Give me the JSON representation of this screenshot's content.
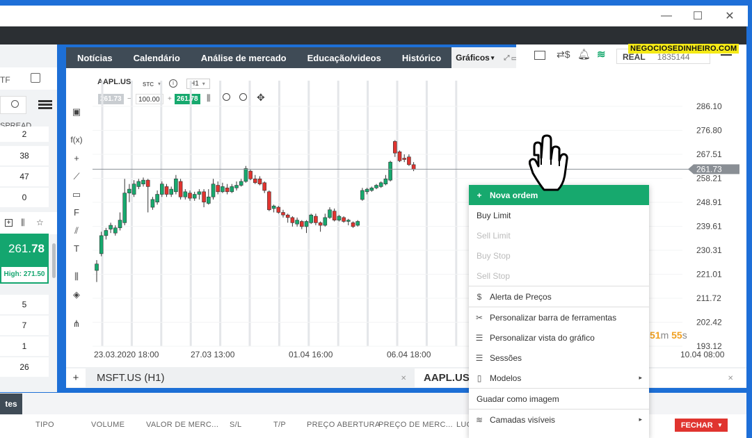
{
  "window": {
    "minimize": "—",
    "maximize": "☐",
    "close": "✕"
  },
  "nav": {
    "items": [
      "Notícias",
      "Calendário",
      "Análise de mercado",
      "Educação/videos",
      "Histórico"
    ],
    "active": "Gráficos",
    "active_arrow": "▾",
    "tab_icons": "⤢▭✕"
  },
  "badge": "NEGOCIOSEDINHEIRO.COM",
  "account": {
    "mode": "REAL",
    "number": "1835144"
  },
  "left_panel": {
    "col_label": "TF",
    "spread_label": "SPREAD",
    "rows_top": [
      "2",
      "38",
      "47",
      "0"
    ],
    "price": "261.",
    "price_bold": "78",
    "high": "High: 271.50",
    "rows_bottom": [
      "5",
      "7",
      "1",
      "26"
    ]
  },
  "chart": {
    "symbol": "AAPL.US",
    "symbol_type": "STC",
    "timeframe": "H1",
    "bid": "261.73",
    "qty": "100.00",
    "ask": "261.78",
    "qty_minus": "−",
    "qty_plus": "+",
    "last_price_label": "261.73",
    "countdown_minutes": "51",
    "countdown_m_unit": "m",
    "countdown_seconds": "55",
    "countdown_s_unit": "s"
  },
  "chart_data": {
    "type": "candlestick",
    "y_ticks": [
      "286.10",
      "276.80",
      "267.51",
      "258.21",
      "248.91",
      "239.61",
      "230.31",
      "221.01",
      "211.72",
      "202.42",
      "193.12"
    ],
    "x_ticks": [
      "23.03.2020 18:00",
      "27.03 13:00",
      "01.04 16:00",
      "06.04 18:00",
      "10.04 08:00"
    ],
    "ylim": [
      193.12,
      286.1
    ],
    "current_price": 261.73,
    "candles": [
      [
        222.5,
        225.0,
        218.0,
        226.5
      ],
      [
        229.0,
        236.0,
        228.0,
        237.5
      ],
      [
        236.0,
        238.0,
        234.5,
        239.0
      ],
      [
        238.5,
        240.0,
        237.0,
        241.0
      ],
      [
        237.0,
        239.0,
        236.0,
        240.0
      ],
      [
        239.0,
        242.0,
        238.0,
        245.0
      ],
      [
        241.0,
        252.5,
        240.0,
        258.0
      ],
      [
        252.5,
        254.0,
        249.0,
        256.0
      ],
      [
        252.0,
        256.0,
        251.0,
        257.5
      ],
      [
        255.0,
        257.0,
        254.0,
        258.0
      ],
      [
        256.0,
        257.5,
        255.0,
        258.5
      ],
      [
        257.5,
        255.0,
        245.0,
        258.0
      ],
      [
        247.0,
        250.0,
        246.0,
        251.0
      ],
      [
        249.0,
        252.0,
        248.0,
        253.5
      ],
      [
        252.0,
        256.0,
        251.0,
        257.0
      ],
      [
        255.0,
        252.0,
        251.0,
        256.0
      ],
      [
        252.0,
        254.0,
        251.0,
        255.0
      ],
      [
        253.0,
        258.0,
        252.0,
        259.5
      ],
      [
        257.0,
        251.0,
        250.0,
        258.0
      ],
      [
        251.0,
        253.0,
        250.0,
        254.0
      ],
      [
        252.5,
        250.5,
        249.5,
        253.5
      ],
      [
        250.5,
        252.0,
        249.5,
        253.0
      ],
      [
        252.0,
        253.0,
        250.0,
        254.0
      ],
      [
        253.0,
        249.0,
        247.0,
        254.0
      ],
      [
        248.5,
        251.0,
        248.0,
        254.0
      ],
      [
        251.0,
        256.0,
        250.0,
        258.0
      ],
      [
        255.5,
        253.0,
        252.0,
        257.0
      ],
      [
        253.0,
        255.0,
        252.5,
        256.5
      ],
      [
        254.5,
        253.0,
        252.0,
        256.0
      ],
      [
        253.0,
        255.0,
        252.5,
        256.0
      ],
      [
        254.5,
        255.5,
        253.5,
        257.0
      ],
      [
        255.5,
        257.0,
        255.0,
        258.0
      ],
      [
        257.0,
        262.0,
        256.5,
        263.0
      ],
      [
        261.0,
        258.0,
        257.5,
        261.5
      ],
      [
        258.0,
        256.5,
        256.0,
        259.5
      ],
      [
        258.0,
        256.0,
        255.5,
        259.0
      ],
      [
        256.5,
        253.5,
        252.5,
        257.0
      ],
      [
        253.0,
        246.0,
        245.5,
        253.5
      ],
      [
        246.5,
        247.5,
        245.0,
        248.0
      ],
      [
        247.0,
        245.0,
        244.5,
        247.5
      ],
      [
        245.0,
        244.0,
        243.0,
        246.0
      ],
      [
        244.0,
        243.0,
        241.0,
        244.5
      ],
      [
        243.0,
        241.0,
        239.5,
        243.5
      ],
      [
        240.5,
        242.0,
        239.5,
        243.0
      ],
      [
        241.5,
        239.5,
        238.5,
        242.0
      ],
      [
        239.5,
        241.5,
        237.0,
        242.0
      ],
      [
        241.0,
        244.0,
        240.5,
        244.5
      ],
      [
        243.5,
        241.0,
        240.0,
        244.5
      ],
      [
        241.0,
        240.0,
        237.5,
        241.5
      ],
      [
        240.0,
        243.0,
        239.5,
        244.5
      ],
      [
        243.0,
        246.0,
        242.5,
        247.0
      ],
      [
        245.5,
        242.0,
        241.5,
        246.5
      ],
      [
        242.0,
        243.5,
        241.5,
        244.0
      ],
      [
        243.0,
        241.5,
        241.0,
        243.5
      ],
      [
        241.5,
        242.0,
        240.0,
        242.5
      ],
      [
        241.0,
        239.5,
        239.0,
        241.5
      ],
      [
        240.0,
        241.5,
        239.5,
        242.0
      ],
      [
        250.0,
        253.5,
        249.5,
        254.5
      ],
      [
        253.0,
        254.0,
        252.0,
        254.5
      ],
      [
        253.5,
        254.5,
        253.0,
        255.0
      ],
      [
        254.5,
        255.5,
        254.0,
        256.0
      ],
      [
        255.0,
        256.5,
        254.5,
        257.0
      ],
      [
        256.0,
        258.0,
        255.5,
        259.5
      ],
      [
        257.5,
        264.5,
        257.0,
        265.0
      ],
      [
        272.5,
        268.0,
        266.5,
        273.0
      ],
      [
        268.5,
        265.0,
        264.5,
        269.0
      ],
      [
        266.0,
        265.5,
        264.5,
        267.5
      ],
      [
        266.5,
        263.5,
        263.0,
        267.5
      ],
      [
        263.5,
        261.7,
        261.0,
        264.5
      ]
    ],
    "vertical_markers": 13
  },
  "bottom_tabs": {
    "add": "+",
    "tab1": "MSFT.US (H1)",
    "tab2": "AAPL.US",
    "close": "✕"
  },
  "positions": {
    "tab": "tes",
    "headers": [
      "TIPO",
      "VOLUME",
      "VALOR DE MERC...",
      "S/L",
      "T/P",
      "PREÇO ABERTURA",
      "PREÇO DE MERC...",
      "LUC"
    ],
    "close_all": "FECHAR",
    "close_arrow": "▾"
  },
  "context_menu": {
    "items": [
      {
        "label": "Nova ordem",
        "icon": "+",
        "state": "primary"
      },
      {
        "label": "Buy Limit",
        "icon": "",
        "state": "normal"
      },
      {
        "label": "Sell Limit",
        "icon": "",
        "state": "disabled"
      },
      {
        "label": "Buy Stop",
        "icon": "",
        "state": "disabled"
      },
      {
        "label": "Sell Stop",
        "icon": "",
        "state": "disabled"
      },
      {
        "label": "Alerta de Preços",
        "icon": "$",
        "state": "normal"
      },
      {
        "label": "Personalizar barra de ferramentas",
        "icon": "✂",
        "state": "normal"
      },
      {
        "label": "Personalizar vista do gráfico",
        "icon": "☰",
        "state": "normal"
      },
      {
        "label": "Sessões",
        "icon": "☰",
        "state": "normal"
      },
      {
        "label": "Modelos",
        "icon": "▯",
        "state": "normal",
        "submenu": true
      },
      {
        "label": "Guadar como imagem",
        "icon": "",
        "state": "normal"
      },
      {
        "label": "Camadas visíveis",
        "icon": "≋",
        "state": "normal",
        "submenu": true
      }
    ],
    "submenu_arrow": "▸"
  }
}
